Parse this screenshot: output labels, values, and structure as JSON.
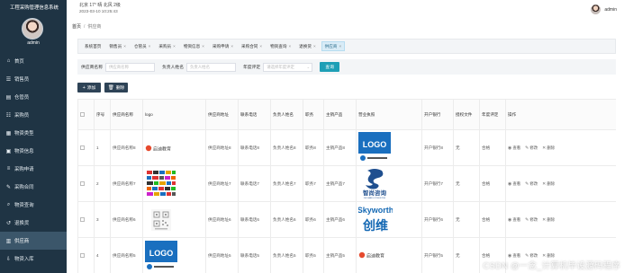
{
  "app": {
    "title": "工程采购管理信息系统",
    "user": "admin"
  },
  "topbar": {
    "weather": "北京 17° 晴 北风 2级",
    "time": "2023-03-10 10:25:43",
    "user": "admin"
  },
  "sidebar": {
    "items": [
      {
        "label": "首页",
        "icon": "home-icon",
        "active": false
      },
      {
        "label": "销售员",
        "icon": "users-icon",
        "active": false
      },
      {
        "label": "仓管员",
        "icon": "warehouse-icon",
        "active": false
      },
      {
        "label": "采购员",
        "icon": "cart-icon",
        "active": false
      },
      {
        "label": "物资类型",
        "icon": "category-icon",
        "active": false
      },
      {
        "label": "物资信息",
        "icon": "box-icon",
        "active": false
      },
      {
        "label": "采购申请",
        "icon": "document-icon",
        "active": false
      },
      {
        "label": "采购合同",
        "icon": "contract-icon",
        "active": false
      },
      {
        "label": "物资查询",
        "icon": "search-icon",
        "active": false
      },
      {
        "label": "退换货",
        "icon": "return-icon",
        "active": false
      },
      {
        "label": "供应商",
        "icon": "supplier-icon",
        "active": true
      },
      {
        "label": "物资入库",
        "icon": "inbound-icon",
        "active": false
      }
    ]
  },
  "breadcrumb": {
    "home": "首页",
    "current": "供应商"
  },
  "tags": [
    {
      "label": "系统首页",
      "closable": false,
      "active": false
    },
    {
      "label": "销售员",
      "closable": true,
      "active": false
    },
    {
      "label": "仓管员",
      "closable": true,
      "active": false
    },
    {
      "label": "采购员",
      "closable": true,
      "active": false
    },
    {
      "label": "物资信息",
      "closable": true,
      "active": false
    },
    {
      "label": "采购申请",
      "closable": true,
      "active": false
    },
    {
      "label": "采购合同",
      "closable": true,
      "active": false
    },
    {
      "label": "物资查询",
      "closable": true,
      "active": false
    },
    {
      "label": "退换货",
      "closable": true,
      "active": false
    },
    {
      "label": "供应商",
      "closable": true,
      "active": true
    }
  ],
  "search": {
    "name_label": "供应商名称",
    "name_placeholder": "供应商名称",
    "contact_label": "负责人姓名",
    "contact_placeholder": "负责人姓名",
    "rating_label": "年度评定",
    "rating_placeholder": "请选择年度评定",
    "button": "查询"
  },
  "actions": {
    "add": "添加",
    "delete": "删除"
  },
  "table": {
    "headers": [
      "",
      "序号",
      "供应商名称",
      "logo",
      "供应商地址",
      "联系电话",
      "负责人姓名",
      "职务",
      "主销产品",
      "营业执照",
      "开户银行",
      "授权文件",
      "年度评定",
      "操作"
    ],
    "rows": [
      {
        "index": "1",
        "name": "供应商名称8",
        "logo": "logo-purple",
        "address": "供应商地址8",
        "phone": "联系电话8",
        "contact": "负责人姓名8",
        "title": "职务8",
        "product": "主销产品8",
        "license": "license-logo",
        "bank": "开户银行8",
        "auth": "无",
        "rating": "合格"
      },
      {
        "index": "2",
        "name": "供应商名称7",
        "logo": "logo-collage",
        "address": "供应商地址7",
        "phone": "联系电话7",
        "contact": "负责人姓名7",
        "title": "职务7",
        "product": "主销产品7",
        "license": "license-zhishang",
        "bank": "开户银行7",
        "auth": "无",
        "rating": "合格"
      },
      {
        "index": "3",
        "name": "供应商名称6",
        "logo": "logo-qr",
        "address": "供应商地址6",
        "phone": "联系电话6",
        "contact": "负责人姓名6",
        "title": "职务6",
        "product": "主销产品6",
        "license": "license-skyworth",
        "bank": "开户银行6",
        "auth": "无",
        "rating": "合格"
      },
      {
        "index": "4",
        "name": "供应商名称5",
        "logo": "logo-blue",
        "address": "供应商地址5",
        "phone": "联系电话5",
        "contact": "负责人姓名5",
        "title": "职务5",
        "product": "主销产品5",
        "license": "license-purple",
        "bank": "开户银行5",
        "auth": "无",
        "rating": "合格"
      }
    ],
    "op_view": "查看",
    "op_edit": "修改",
    "op_delete": "删除"
  },
  "brand_text": {
    "logo_word": "LOGO",
    "purple_brand": "启迪教育",
    "zhishang_cn": "智尚咨询",
    "zhishang_en": "ZHI SHANG CONSULTING",
    "skyworth_en": "Skyworth",
    "skyworth_cn": "创维"
  },
  "watermark": "CSDN @一念_计算机毕设源码程序",
  "colors": {
    "sidebar": "#1f3444",
    "sidebar_active": "#3b566a",
    "search_button": "#1e9fb6",
    "action_button": "#2e4356",
    "active_tag": "#d9ecf7"
  }
}
